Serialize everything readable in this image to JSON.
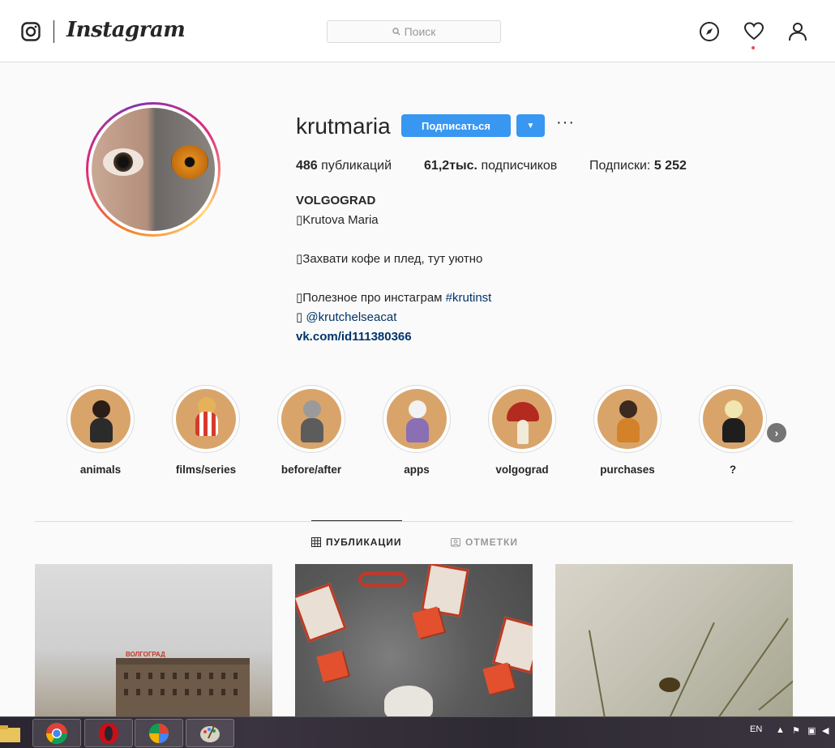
{
  "nav": {
    "wordmark": "Instagram",
    "search_placeholder": "Поиск"
  },
  "profile": {
    "username": "krutmaria",
    "follow_label": "Подписаться",
    "dropdown_glyph": "▼",
    "more_glyph": "···",
    "stats": {
      "posts_count": "486",
      "posts_label": "публикаций",
      "followers_count": "61,2тыс.",
      "followers_label": "подписчиков",
      "following_label": "Подписки:",
      "following_count": "5 252"
    },
    "bio": {
      "name": "VOLGOGRAD",
      "line1": "Krutova Maria",
      "line2": "Захвати кофе и плед, тут уютно",
      "line3_text": "Полезное про инстаграм ",
      "line3_tag": "#krutinst",
      "line4": "@krutchelseacat",
      "link": "vk.com/id111380366"
    }
  },
  "highlights": [
    {
      "label": "animals"
    },
    {
      "label": "films/series"
    },
    {
      "label": "before/after"
    },
    {
      "label": "apps"
    },
    {
      "label": "volgograd"
    },
    {
      "label": "purchases"
    },
    {
      "label": "?"
    }
  ],
  "tabs": {
    "posts": "ПУБЛИКАЦИИ",
    "tagged": "ОТМЕТКИ"
  },
  "posts": {
    "post1_sign": "ВОЛГОГРАД"
  },
  "taskbar": {
    "lang": "EN"
  },
  "colors": {
    "accent": "#3897f0",
    "notification": "#ed4956",
    "link": "#003569",
    "highlight_bg": "#d9a46a"
  }
}
